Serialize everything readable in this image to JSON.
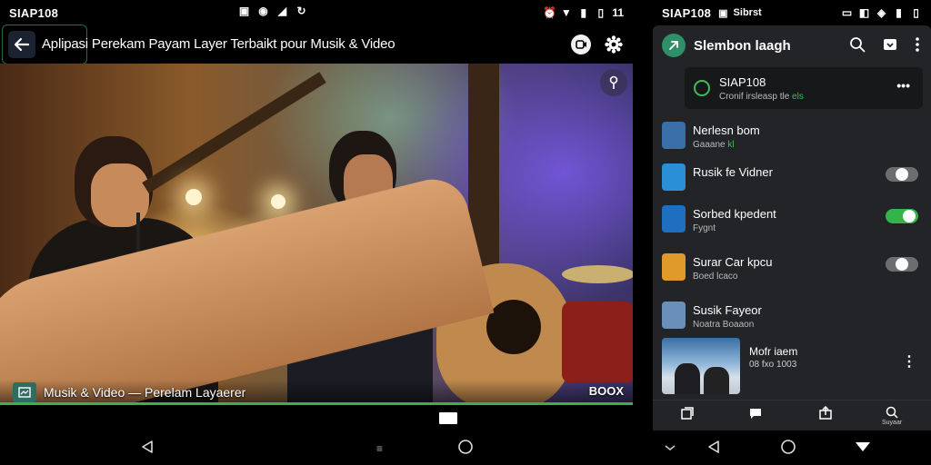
{
  "left": {
    "status": {
      "clock": "SIAP108",
      "right_text": "11"
    },
    "titlebar": {
      "title": "Aplipasi Perekam Payam Layer Terbaikt pour Musik & Video"
    },
    "video": {
      "caption": "Musik & Video — Perelam Layaerer",
      "badge": "BOOX",
      "progress": 1.0
    }
  },
  "right": {
    "status": {
      "clock": "SIAP108",
      "extra": "Sibrst"
    },
    "app": {
      "name": "Slembon laagh"
    },
    "card": {
      "title": "SIAP108",
      "sub": "Cronif irsleasp tle",
      "sub_hl": "els"
    },
    "items": [
      {
        "title": "Nerlesn bom",
        "sub": "Gaaane",
        "sub_hl": "kl",
        "thumb": "#3a6fa8",
        "toggle": null
      },
      {
        "title": "Rusik fe Vidner",
        "sub": "",
        "sub_hl": "",
        "thumb": "#2b8fd6",
        "toggle": "off"
      },
      {
        "title": "Sorbed kpedent",
        "sub": "Fygnt",
        "sub_hl": "",
        "thumb": "#1f6fc0",
        "toggle": "on"
      },
      {
        "title": "Surar Car kpcu",
        "sub": "Boed lcaco",
        "sub_hl": "",
        "thumb": "#e09a2a",
        "toggle": "off"
      },
      {
        "title": "Susik Fayeor",
        "sub": "Noatra Boaaon",
        "sub_hl": "",
        "thumb": "#6a8fb8",
        "toggle": null
      }
    ],
    "media": {
      "title": "Mofr iaem",
      "sub": "08 fxo 1003"
    },
    "tabs": [
      {
        "icon": "library-icon",
        "label": ""
      },
      {
        "icon": "chat-icon",
        "label": ""
      },
      {
        "icon": "share-icon",
        "label": ""
      },
      {
        "icon": "search-icon",
        "label": "Suyaar"
      }
    ]
  },
  "colors": {
    "accent": "#38b349",
    "panel": "#232427",
    "card": "#17181a"
  }
}
